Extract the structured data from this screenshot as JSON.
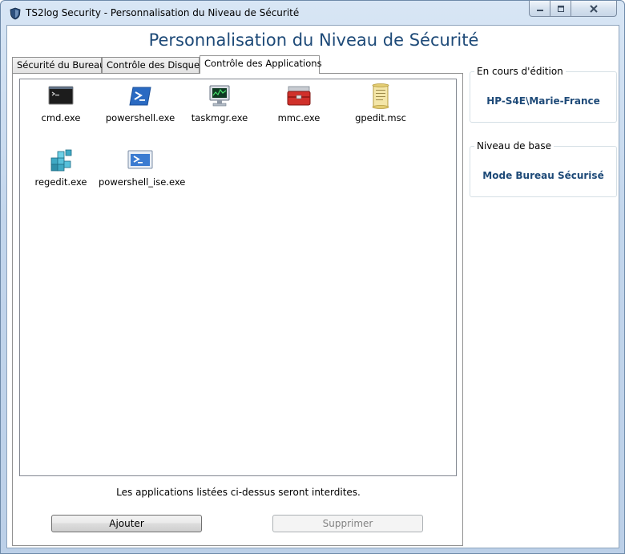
{
  "window": {
    "title": "TS2log Security - Personnalisation du Niveau de Sécurité",
    "controls": [
      "minimize-icon",
      "maximize-icon",
      "close-icon"
    ]
  },
  "header": {
    "title": "Personnalisation du Niveau de Sécurité"
  },
  "tabs": [
    {
      "label": "Sécurité du Bureau"
    },
    {
      "label": "Contrôle des Disques"
    },
    {
      "label": "Contrôle des Applications"
    }
  ],
  "active_tab": "Contrôle des Applications",
  "applications": [
    {
      "name": "cmd.exe",
      "icon": "console-icon"
    },
    {
      "name": "powershell.exe",
      "icon": "powershell-icon"
    },
    {
      "name": "taskmgr.exe",
      "icon": "task-manager-icon"
    },
    {
      "name": "mmc.exe",
      "icon": "toolbox-icon"
    },
    {
      "name": "gpedit.msc",
      "icon": "scroll-icon"
    },
    {
      "name": "regedit.exe",
      "icon": "registry-icon"
    },
    {
      "name": "powershell_ise.exe",
      "icon": "powershell-ise-icon"
    }
  ],
  "notice": "Les applications listées ci-dessus seront interdites.",
  "buttons": {
    "add": "Ajouter",
    "remove": "Supprimer"
  },
  "editing": {
    "legend": "En cours d'édition",
    "value": "HP-S4E\\Marie-France"
  },
  "base_level": {
    "legend": "Niveau de base",
    "value": "Mode Bureau Sécurisé"
  },
  "colors": {
    "accent": "#1e4a78",
    "window_frame": "#c3d6ec"
  }
}
